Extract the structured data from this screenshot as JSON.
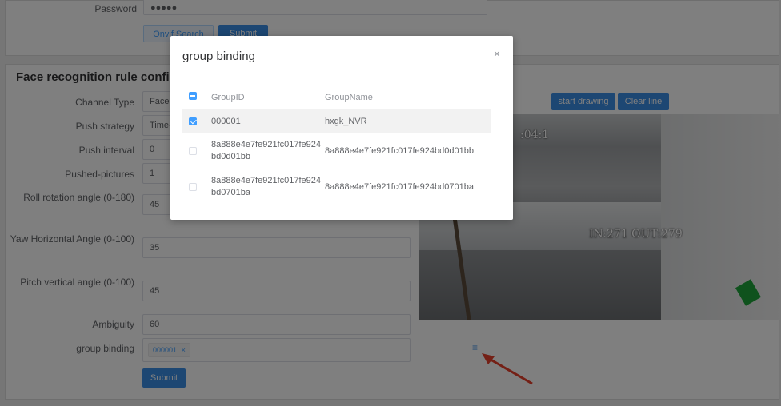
{
  "top_form": {
    "password_label": "Password",
    "password_value": "●●●●●",
    "onvif_search_label": "Onvif Search",
    "submit_label": "Submit"
  },
  "rule_form": {
    "title": "Face recognition rule config",
    "fields": [
      {
        "label": "Channel Type",
        "value": "Face"
      },
      {
        "label": "Push strategy",
        "value": "Time-"
      },
      {
        "label": "Push interval",
        "value": "0"
      },
      {
        "label": "Pushed-pictures",
        "value": "1"
      },
      {
        "label": "Roll rotation angle (0-180)",
        "value": "45"
      },
      {
        "label": "Yaw Horizontal Angle (0-100)",
        "value": "35"
      },
      {
        "label": "Pitch vertical angle (0-100)",
        "value": "45"
      },
      {
        "label": "Ambiguity",
        "value": "60"
      }
    ],
    "group_binding_label": "group binding",
    "group_binding_tag": "000001",
    "submit_label": "Submit"
  },
  "video": {
    "start_drawing_label": "start drawing",
    "clear_line_label": "Clear line",
    "overlay_time": ":04:1",
    "overlay_counter": "IN:271 OUT:279"
  },
  "dialog": {
    "title": "group binding",
    "close_icon": "×",
    "columns": {
      "id": "GroupID",
      "name": "GroupName"
    },
    "rows": [
      {
        "id": "000001",
        "name": "hxgk_NVR",
        "checked": true
      },
      {
        "id": "8a888e4e7fe921fc017fe924bd0d01bb",
        "name": "8a888e4e7fe921fc017fe924bd0d01bb",
        "checked": false
      },
      {
        "id": "8a888e4e7fe921fc017fe924bd0701ba",
        "name": "8a888e4e7fe921fc017fe924bd0701ba",
        "checked": false
      }
    ]
  },
  "colors": {
    "primary": "#409eff",
    "arrow": "#e8412c"
  },
  "icons": {
    "list": "list-icon",
    "close": "close-icon",
    "tag_close": "×"
  }
}
